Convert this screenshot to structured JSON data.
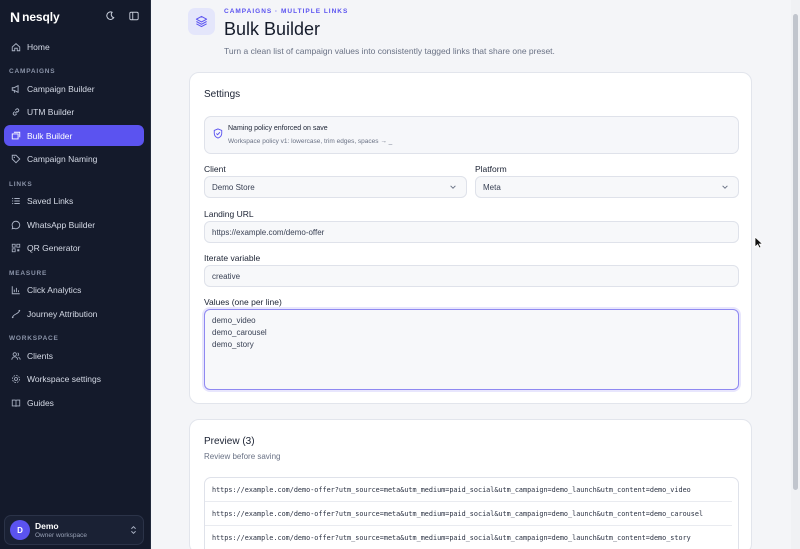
{
  "brand": {
    "mark": "N",
    "name": "nesqly"
  },
  "sidebar": {
    "home": "Home",
    "sections": [
      "CAMPAIGNS",
      "LINKS",
      "MEASURE",
      "WORKSPACE"
    ],
    "campaigns": [
      "Campaign Builder",
      "UTM Builder",
      "Bulk Builder",
      "Campaign Naming"
    ],
    "links": [
      "Saved Links",
      "WhatsApp Builder",
      "QR Generator"
    ],
    "measure": [
      "Click Analytics",
      "Journey Attribution"
    ],
    "workspace": [
      "Clients",
      "Workspace settings",
      "Guides"
    ],
    "active": "Bulk Builder"
  },
  "user": {
    "initial": "D",
    "name": "Demo",
    "role": "Owner workspace"
  },
  "header": {
    "eyebrow": "CAMPAIGNS · MULTIPLE LINKS",
    "title": "Bulk Builder",
    "subtitle": "Turn a clean list of campaign values into consistently tagged links that share one preset."
  },
  "settings": {
    "title": "Settings",
    "notice_title": "Naming policy enforced on save",
    "notice_text": "Workspace policy v1: lowercase, trim edges, spaces → _",
    "client_label": "Client",
    "client_value": "Demo Store",
    "platform_label": "Platform",
    "platform_value": "Meta",
    "landing_label": "Landing URL",
    "landing_value": "https://example.com/demo-offer",
    "iterate_label": "Iterate variable",
    "iterate_value": "creative",
    "values_label": "Values (one per line)",
    "values": [
      "demo_video",
      "demo_carousel",
      "demo_story"
    ]
  },
  "preview": {
    "title": "Preview (3)",
    "subtitle": "Review before saving",
    "rows": [
      "https://example.com/demo-offer?utm_source=meta&utm_medium=paid_social&utm_campaign=demo_launch&utm_content=demo_video",
      "https://example.com/demo-offer?utm_source=meta&utm_medium=paid_social&utm_campaign=demo_launch&utm_content=demo_carousel",
      "https://example.com/demo-offer?utm_source=meta&utm_medium=paid_social&utm_campaign=demo_launch&utm_content=demo_story"
    ]
  },
  "colors": {
    "accent": "#5b53f0",
    "sidebar": "#141a2b"
  }
}
